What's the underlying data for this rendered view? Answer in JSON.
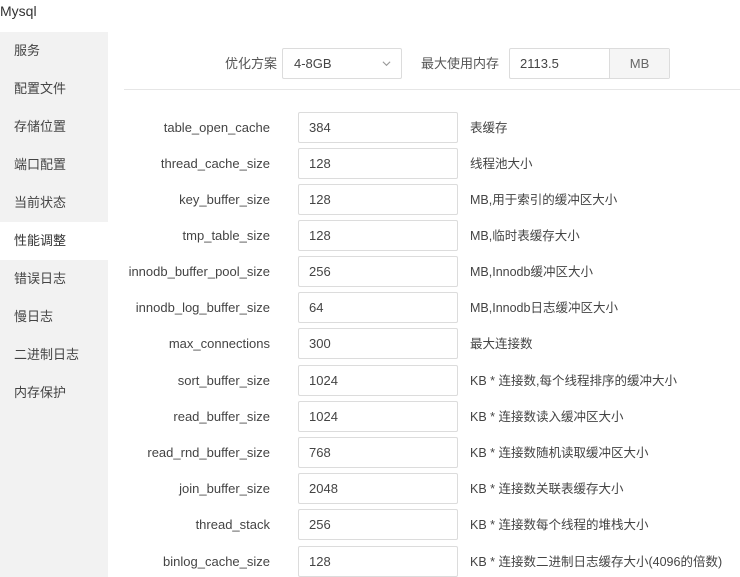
{
  "window": {
    "title": "Mysql"
  },
  "sidebar": {
    "items": [
      {
        "label": "服务"
      },
      {
        "label": "配置文件"
      },
      {
        "label": "存储位置"
      },
      {
        "label": "端口配置"
      },
      {
        "label": "当前状态"
      },
      {
        "label": "性能调整"
      },
      {
        "label": "错误日志"
      },
      {
        "label": "慢日志"
      },
      {
        "label": "二进制日志"
      },
      {
        "label": "内存保护"
      }
    ],
    "active_index": 5
  },
  "toolbar": {
    "plan_label": "优化方案",
    "plan_value": "4-8GB",
    "mem_label": "最大使用内存",
    "mem_value": "2113.5",
    "mem_unit": "MB"
  },
  "params": [
    {
      "name": "table_open_cache",
      "value": "384",
      "desc": "表缓存"
    },
    {
      "name": "thread_cache_size",
      "value": "128",
      "desc": "线程池大小"
    },
    {
      "name": "key_buffer_size",
      "value": "128",
      "desc": "MB,用于索引的缓冲区大小"
    },
    {
      "name": "tmp_table_size",
      "value": "128",
      "desc": "MB,临时表缓存大小"
    },
    {
      "name": "innodb_buffer_pool_size",
      "value": "256",
      "desc": "MB,Innodb缓冲区大小"
    },
    {
      "name": "innodb_log_buffer_size",
      "value": "64",
      "desc": "MB,Innodb日志缓冲区大小"
    },
    {
      "name": "max_connections",
      "value": "300",
      "desc": "最大连接数"
    },
    {
      "name": "sort_buffer_size",
      "value": "1024",
      "desc": "KB * 连接数,每个线程排序的缓冲大小"
    },
    {
      "name": "read_buffer_size",
      "value": "1024",
      "desc": "KB * 连接数读入缓冲区大小"
    },
    {
      "name": "read_rnd_buffer_size",
      "value": "768",
      "desc": "KB * 连接数随机读取缓冲区大小"
    },
    {
      "name": "join_buffer_size",
      "value": "2048",
      "desc": "KB * 连接数关联表缓存大小"
    },
    {
      "name": "thread_stack",
      "value": "256",
      "desc": "KB * 连接数每个线程的堆栈大小"
    },
    {
      "name": "binlog_cache_size",
      "value": "128",
      "desc": "KB * 连接数二进制日志缓存大小(4096的倍数)"
    }
  ]
}
